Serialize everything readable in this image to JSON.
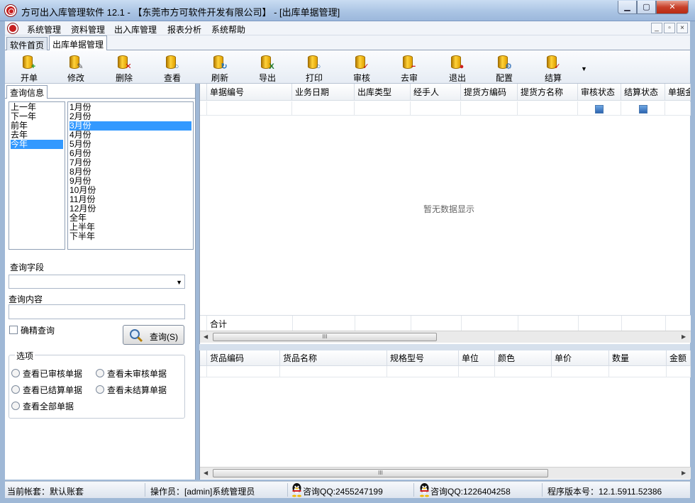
{
  "window": {
    "title": "方可出入库管理软件 12.1 - 【东莞市方可软件开发有限公司】 - [出库单据管理]",
    "min": "▁",
    "max": "▢",
    "close": "✕"
  },
  "menu": [
    "系统管理",
    "资料管理",
    "出入库管理",
    "报表分析",
    "系统帮助"
  ],
  "mdi": {
    "min": "_",
    "restore": "▫",
    "close": "×"
  },
  "tabs": [
    "软件首页",
    "出库单据管理"
  ],
  "toolbar": [
    {
      "label": "开单",
      "icon": "add-icon",
      "badge": "+",
      "color": "#1e9a1e"
    },
    {
      "label": "修改",
      "icon": "edit-icon",
      "badge": "✎",
      "color": "#555555"
    },
    {
      "label": "删除",
      "icon": "delete-icon",
      "badge": "✕",
      "color": "#cc1010"
    },
    {
      "label": "查看",
      "icon": "search-icon",
      "badge": "○",
      "color": "#2a6ab4"
    },
    {
      "label": "刷新",
      "icon": "refresh-icon",
      "badge": "↻",
      "color": "#1a70c0"
    },
    {
      "label": "导出",
      "icon": "excel-icon",
      "badge": "X",
      "color": "#1e7a2e"
    },
    {
      "label": "打印",
      "icon": "print-icon",
      "badge": "○",
      "color": "#2a6ab4"
    },
    {
      "label": "审核",
      "icon": "approve-icon",
      "badge": "✓",
      "color": "#cc1010"
    },
    {
      "label": "去审",
      "icon": "unapprove-icon",
      "badge": "−",
      "color": "#cc1010"
    },
    {
      "label": "退出",
      "icon": "exit-icon",
      "badge": "●",
      "color": "#cc2020"
    },
    {
      "label": "配置",
      "icon": "config-icon",
      "badge": "⚙",
      "color": "#1a5fb0"
    },
    {
      "label": "结算",
      "icon": "settle-icon",
      "badge": "✓",
      "color": "#cc1010"
    }
  ],
  "toolbar_more": "▼",
  "query": {
    "tab_label": "查询信息",
    "years": [
      "上一年",
      "下一年",
      "前年",
      "去年",
      "今年"
    ],
    "selected_year": "今年",
    "months": [
      "1月份",
      "2月份",
      "3月份",
      "4月份",
      "5月份",
      "6月份",
      "7月份",
      "8月份",
      "9月份",
      "10月份",
      "11月份",
      "12月份",
      "全年",
      "上半年",
      "下半年"
    ],
    "selected_month": "3月份",
    "field_label": "查询字段",
    "field_value": "",
    "content_label": "查询内容",
    "content_value": "",
    "exact_label": "确精查询",
    "search_button": "查询(S)",
    "options_label": "选项",
    "options": [
      "查看已审核单据",
      "查看未审核单据",
      "查看已结算单据",
      "查看未结算单据",
      "查看全部单据"
    ]
  },
  "main_grid": {
    "columns": [
      "单据编号",
      "业务日期",
      "出库类型",
      "经手人",
      "提货方编码",
      "提货方名称",
      "审核状态",
      "结算状态",
      "单据金"
    ],
    "empty_text": "暂无数据显示",
    "footer_label": "合计",
    "scroll_grip": "III",
    "arrow_left": "◀",
    "arrow_right": "▶"
  },
  "sub_grid": {
    "columns": [
      "货品编码",
      "货品名称",
      "规格型号",
      "单位",
      "颜色",
      "单价",
      "数量",
      "金额"
    ]
  },
  "status": {
    "account": "当前帐套：默认账套",
    "operator": "操作员：[admin]系统管理员",
    "qq1": "咨询QQ:2455247199",
    "qq2": "咨询QQ:1226404258",
    "version": "程序版本号：12.1.5911.52386"
  }
}
